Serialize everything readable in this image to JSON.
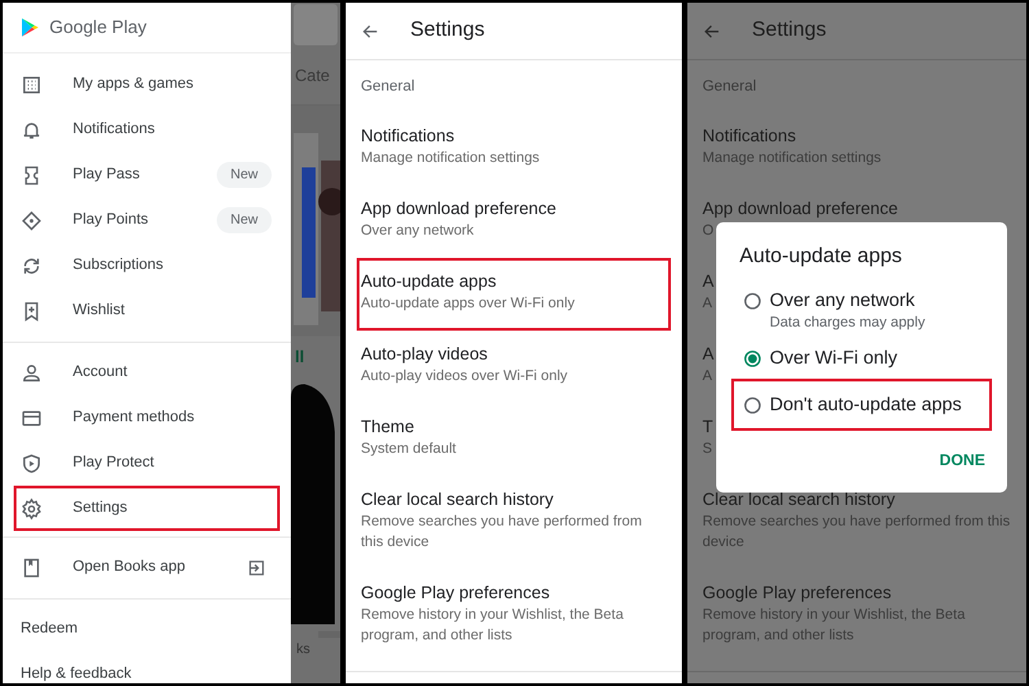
{
  "drawer_screen": {
    "app_name": "Google Play",
    "menu_groups": [
      {
        "items": [
          {
            "label": "My apps & games",
            "highlighted": false
          },
          {
            "label": "Notifications",
            "highlighted": false
          },
          {
            "label": "Play Pass",
            "badge": "New",
            "highlighted": false
          },
          {
            "label": "Play Points",
            "badge": "New",
            "highlighted": false
          },
          {
            "label": "Subscriptions",
            "highlighted": false
          },
          {
            "label": "Wishlist",
            "highlighted": false
          }
        ]
      },
      {
        "items": [
          {
            "label": "Account",
            "highlighted": false
          },
          {
            "label": "Payment methods",
            "highlighted": false
          },
          {
            "label": "Play Protect",
            "highlighted": false
          },
          {
            "label": "Settings",
            "highlighted": true
          }
        ]
      },
      {
        "items": [
          {
            "label": "Open Books app",
            "highlighted": false
          }
        ]
      }
    ],
    "footer_links": [
      {
        "label": "Redeem"
      },
      {
        "label": "Help & feedback"
      }
    ],
    "background_texts": [
      "Cate",
      "ll",
      "ks"
    ]
  },
  "settings_screen": {
    "title": "Settings",
    "section": "General",
    "items": [
      {
        "title": "Notifications",
        "subtitle": "Manage notification settings",
        "highlighted": false
      },
      {
        "title": "App download preference",
        "subtitle": "Over any network",
        "highlighted": false
      },
      {
        "title": "Auto-update apps",
        "subtitle": "Auto-update apps over Wi-Fi only",
        "highlighted": true
      },
      {
        "title": "Auto-play videos",
        "subtitle": "Auto-play videos over Wi-Fi only",
        "highlighted": false
      },
      {
        "title": "Theme",
        "subtitle": "System default",
        "highlighted": false
      },
      {
        "title": "Clear local search history",
        "subtitle": "Remove searches you have performed from this device",
        "highlighted": false
      },
      {
        "title": "Google Play preferences",
        "subtitle": "Remove history in your Wishlist, the Beta program, and other lists",
        "highlighted": false
      }
    ]
  },
  "dialog_screen": {
    "title": "Settings",
    "section": "General",
    "items": [
      {
        "title": "Notifications",
        "subtitle": "Manage notification settings"
      },
      {
        "title": "App download preference",
        "subtitle": "O"
      },
      {
        "title": "A",
        "subtitle": "A"
      },
      {
        "title": "A",
        "subtitle": "A"
      },
      {
        "title": "T",
        "subtitle": "S"
      },
      {
        "title": "Clear local search history",
        "subtitle": "Remove searches you have performed from this device"
      },
      {
        "title": "Google Play preferences",
        "subtitle": "Remove history in your Wishlist, the Beta program, and other lists"
      }
    ],
    "dialog": {
      "title": "Auto-update apps",
      "options": [
        {
          "label": "Over any network",
          "description": "Data charges may apply",
          "selected": false,
          "highlighted": false
        },
        {
          "label": "Over Wi-Fi only",
          "selected": true,
          "highlighted": false
        },
        {
          "label": "Don't auto-update apps",
          "selected": false,
          "highlighted": true
        }
      ],
      "button": "DONE"
    }
  }
}
